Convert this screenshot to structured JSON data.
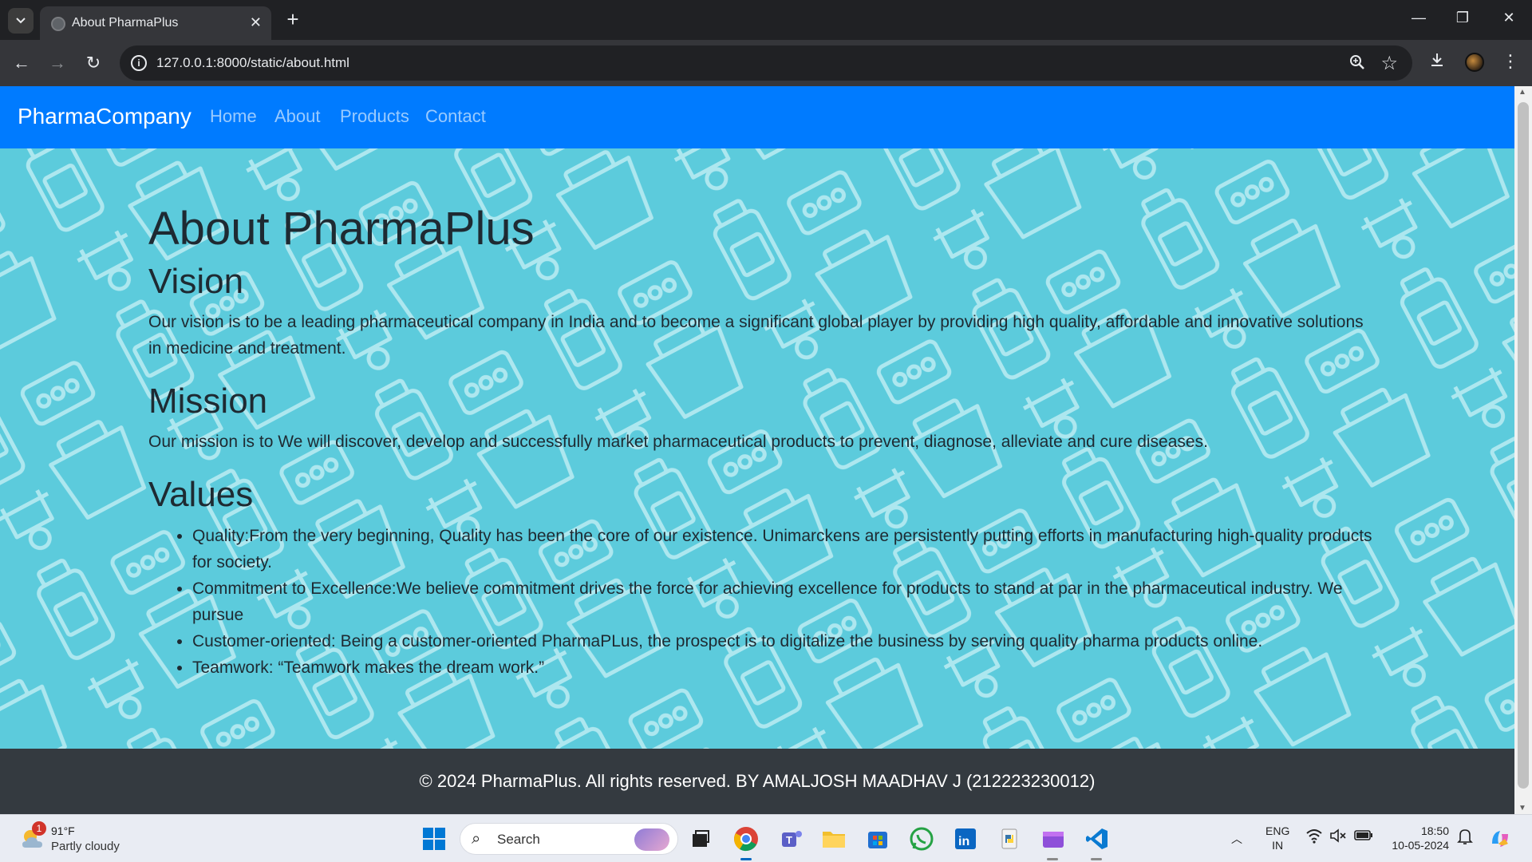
{
  "browser": {
    "tab_title": "About PharmaPlus",
    "tab_close": "✕",
    "new_tab": "+",
    "url": "127.0.0.1:8000/static/about.html",
    "window_controls": {
      "minimize": "—",
      "restore": "❐",
      "close": "✕"
    }
  },
  "navbar": {
    "brand": "PharmaCompany",
    "links": [
      "Home",
      "About",
      "Products",
      "Contact"
    ]
  },
  "page": {
    "heading": "About PharmaPlus",
    "vision": {
      "title": "Vision",
      "text": "Our vision is to be a leading pharmaceutical company in India and to become a significant global player by providing high quality, affordable and innovative solutions in medicine and treatment."
    },
    "mission": {
      "title": "Mission",
      "text": "Our mission is to We will discover, develop and successfully market pharmaceutical products to prevent, diagnose, alleviate and cure diseases."
    },
    "values": {
      "title": "Values",
      "items": [
        "Quality:From the very beginning, Quality has been the core of our existence. Unimarckens are persistently putting efforts in manufacturing high-quality products for society.",
        "Commitment to Excellence:We believe commitment drives the force for achieving excellence for products to stand at par in the pharmaceutical industry. We pursue",
        "Customer-oriented: Being a customer-oriented PharmaPLus, the prospect is to digitalize the business by serving quality pharma products online.",
        "Teamwork: “Teamwork makes the dream work.”"
      ]
    },
    "footer": "© 2024 PharmaPlus. All rights reserved. BY AMALJOSH MAADHAV J (212223230012)"
  },
  "taskbar": {
    "weather_badge": "1",
    "weather_temp": "91°F",
    "weather_desc": "Partly cloudy",
    "search_label": "Search",
    "lang_line1": "ENG",
    "lang_line2": "IN",
    "time": "18:50",
    "date": "10-05-2024"
  },
  "colors": {
    "navbar": "#007bff",
    "hero_bg": "#5ccbdc",
    "footer": "#343a40"
  }
}
